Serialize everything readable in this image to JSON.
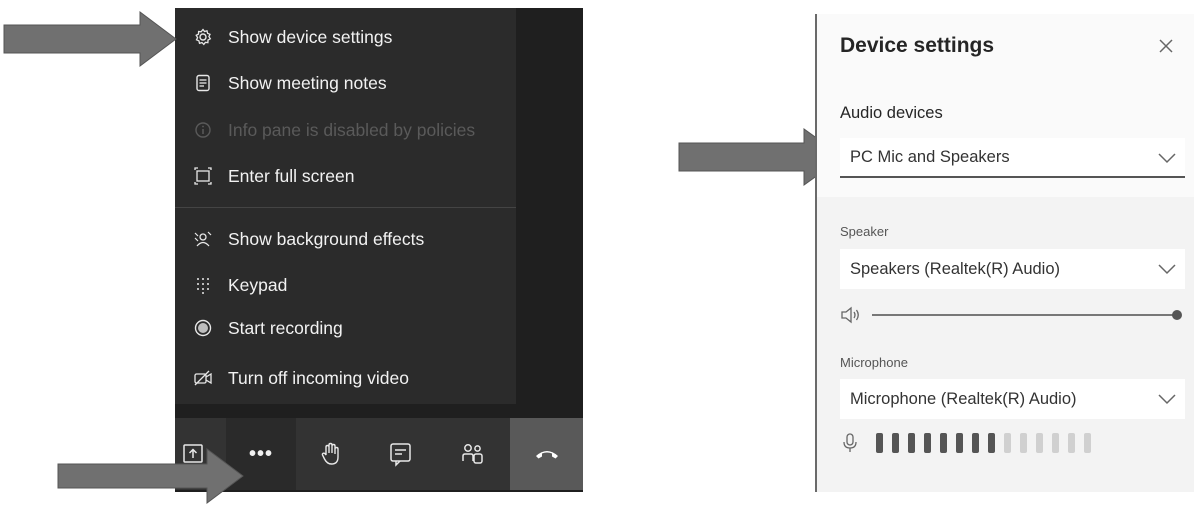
{
  "menu": {
    "items": [
      {
        "label": "Show device settings",
        "icon": "gear-icon"
      },
      {
        "label": "Show meeting notes",
        "icon": "notes-icon"
      },
      {
        "label": "Info pane is disabled by policies",
        "icon": "info-icon"
      },
      {
        "label": "Enter full screen",
        "icon": "fullscreen-icon"
      },
      {
        "label": "Show background effects",
        "icon": "background-effects-icon"
      },
      {
        "label": "Keypad",
        "icon": "keypad-icon"
      },
      {
        "label": "Start recording",
        "icon": "record-icon"
      },
      {
        "label": "Turn off incoming video",
        "icon": "video-off-icon"
      }
    ]
  },
  "toolbar": {
    "buttons": [
      "share-icon",
      "more-options-icon",
      "raise-hand-icon",
      "chat-icon",
      "participants-icon",
      "hang-up-icon"
    ],
    "more_label": "•••"
  },
  "settings": {
    "title": "Device settings",
    "audio_devices_label": "Audio devices",
    "audio_devices_value": "PC Mic and Speakers",
    "speaker_label": "Speaker",
    "speaker_value": "Speakers (Realtek(R) Audio)",
    "speaker_volume": 1.0,
    "microphone_label": "Microphone",
    "microphone_value": "Microphone (Realtek(R) Audio)",
    "mic_level_total": 14,
    "mic_level_active": 8
  },
  "colors": {
    "menu_bg": "#2b2b2b",
    "arrow": "#6e6e6e",
    "level_active": "#555555",
    "level_inactive": "#d0d0d0"
  }
}
